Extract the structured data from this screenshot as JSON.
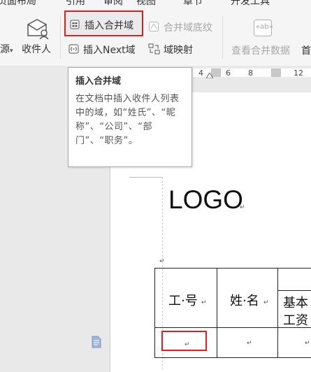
{
  "menubar": {
    "items": [
      "页面布局",
      "引用",
      "审阅",
      "视图",
      "章节",
      "开发工具"
    ]
  },
  "ribbon": {
    "left_partial": "源",
    "recipients": "收件人",
    "insert_merge_field": "插入合并域",
    "insert_next_field": "插入Next域",
    "merge_field_shading": "合并域底纹",
    "field_mapping": "域映射",
    "view_merged_data": "查看合并数据",
    "first_partial": "首",
    "abc_glyph": "«ab»"
  },
  "ruler": {
    "ticks": [
      "4",
      "6",
      "8",
      "10",
      "12"
    ]
  },
  "tooltip": {
    "title": "插入合并域",
    "body": "在文档中插入收件人列表中的域，如“姓氏”、“昵称”、“公司”、“部门”、“职务”。"
  },
  "document": {
    "logo": "LOGO",
    "table": {
      "col1_header": "工·号",
      "col2_header": "姓·名",
      "col3_header_line1": "基本",
      "col3_header_line2": "工资"
    },
    "paragraph_mark": "↵"
  },
  "colors": {
    "highlight_red": "#e02020",
    "accent_blue": "#2b79d3"
  }
}
